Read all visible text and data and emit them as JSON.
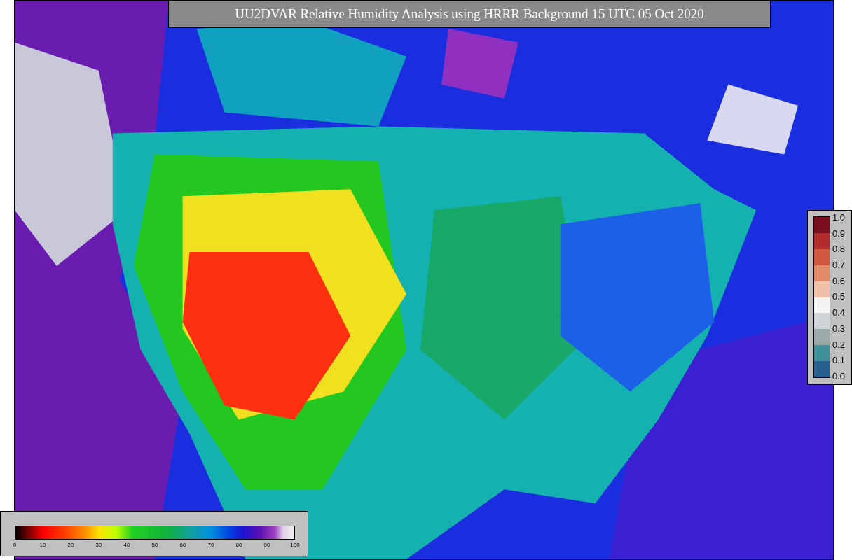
{
  "title": "UU2DVAR Relative Humidity Analysis using HRRR Background 15 UTC 05 Oct 2020",
  "observation_scale": {
    "ticks": [
      "1.0",
      "0.9",
      "0.8",
      "0.7",
      "0.6",
      "0.5",
      "0.4",
      "0.3",
      "0.2",
      "0.1",
      "0.0"
    ]
  },
  "humidity_scale": {
    "ticks": [
      "0",
      "10",
      "20",
      "30",
      "40",
      "50",
      "60",
      "70",
      "80",
      "90",
      "100"
    ]
  }
}
